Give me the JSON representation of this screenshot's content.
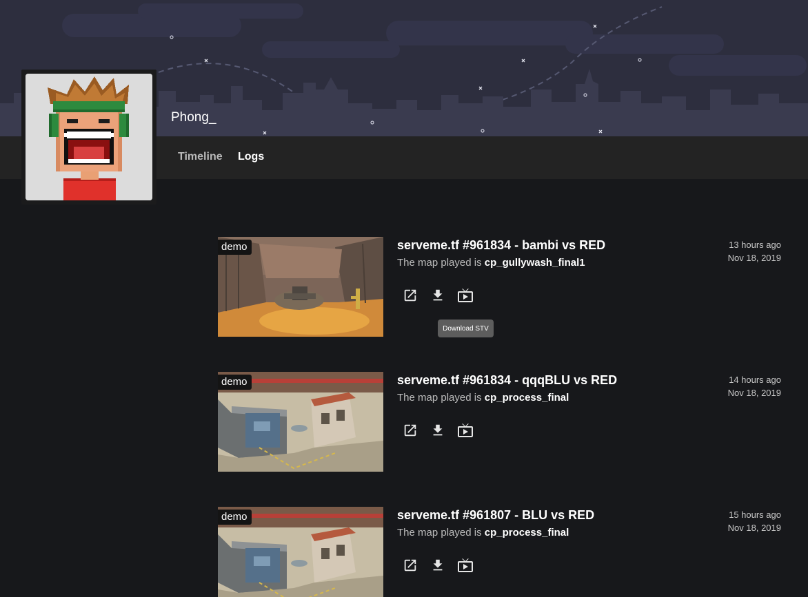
{
  "profile": {
    "name": "Phong_"
  },
  "nav": {
    "tabs": [
      {
        "label": "Timeline",
        "active": false
      },
      {
        "label": "Logs",
        "active": true
      }
    ]
  },
  "logs": [
    {
      "badge": "demo",
      "title": "serveme.tf #961834 - bambi vs RED",
      "map_prefix": "The map played is ",
      "map": "cp_gullywash_final1",
      "time_ago": "13 hours ago",
      "date": "Nov 18, 2019"
    },
    {
      "badge": "demo",
      "title": "serveme.tf #961834 - qqqBLU vs RED",
      "map_prefix": "The map played is ",
      "map": "cp_process_final",
      "time_ago": "14 hours ago",
      "date": "Nov 18, 2019"
    },
    {
      "badge": "demo",
      "title": "serveme.tf #961807 - BLU vs RED",
      "map_prefix": "The map played is ",
      "map": "cp_process_final",
      "time_ago": "15 hours ago",
      "date": "Nov 18, 2019"
    }
  ],
  "icons": {
    "open": "open-in-new-icon",
    "download": "download-icon",
    "stv": "tv-play-icon"
  },
  "tooltip": {
    "text": "Download STV"
  },
  "colors": {
    "background": "#17181b",
    "banner": "#2d2e3e",
    "navbar": "#232323",
    "tooltip": "#5d5d5d"
  }
}
